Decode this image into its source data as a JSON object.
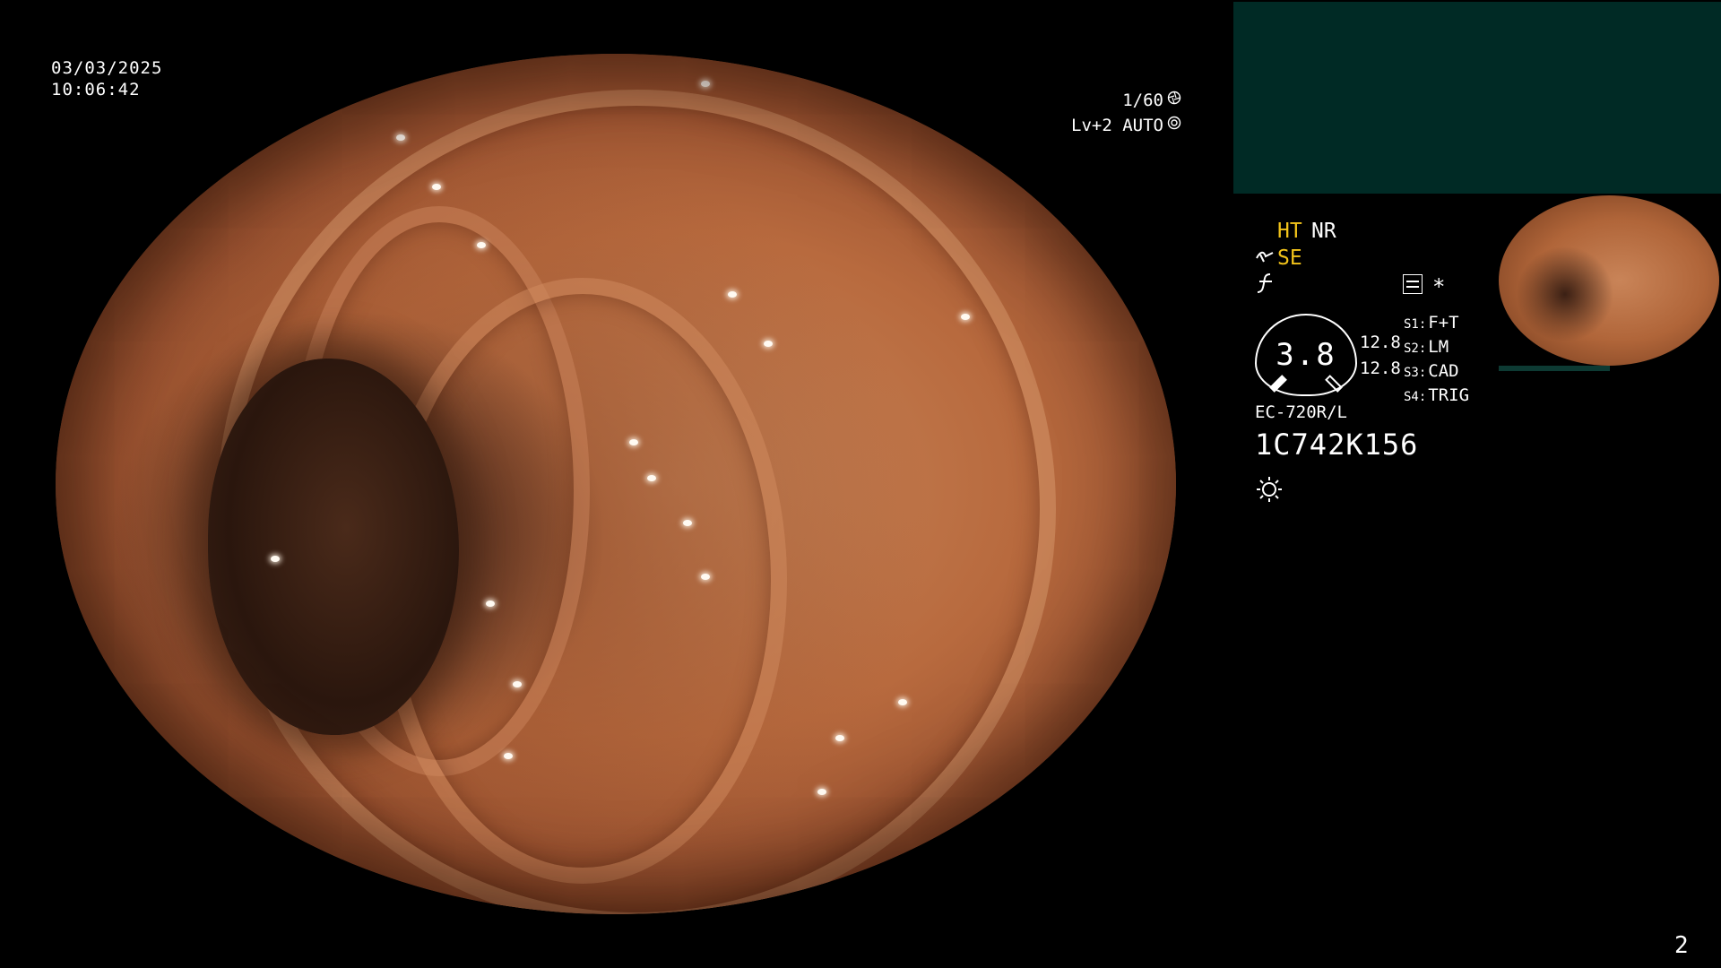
{
  "overlay": {
    "date": "03/03/2025",
    "time": "10:06:42",
    "shutter": "1/60",
    "shutter_icon": "aperture-icon",
    "brightness": "Lv+2 AUTO",
    "brightness_icon": "auto-iris-icon"
  },
  "status_panel": {
    "ht_label": "HT",
    "nr_label": "NR",
    "se_label": "SE",
    "se_icon": "structure-enhance-icon",
    "function_icon": "function-icon",
    "memo_icon": "memo-icon",
    "star_label": "*",
    "gauge_value": "3.8",
    "aux_values": [
      "12.8",
      "12.8"
    ],
    "switches": [
      {
        "key": "S1:",
        "value": "F+T"
      },
      {
        "key": "S2:",
        "value": "LM"
      },
      {
        "key": "S3:",
        "value": "CAD"
      },
      {
        "key": "S4:",
        "value": "TRIG"
      }
    ],
    "scope_model": "EC-720R/L",
    "scope_serial": "1C742K156",
    "light_icon": "light-source-icon"
  },
  "colors": {
    "accent_yellow": "#f2c31a",
    "panel_teal": "#002a25",
    "text": "#ffffff"
  },
  "footer": {
    "page_number": "2"
  }
}
